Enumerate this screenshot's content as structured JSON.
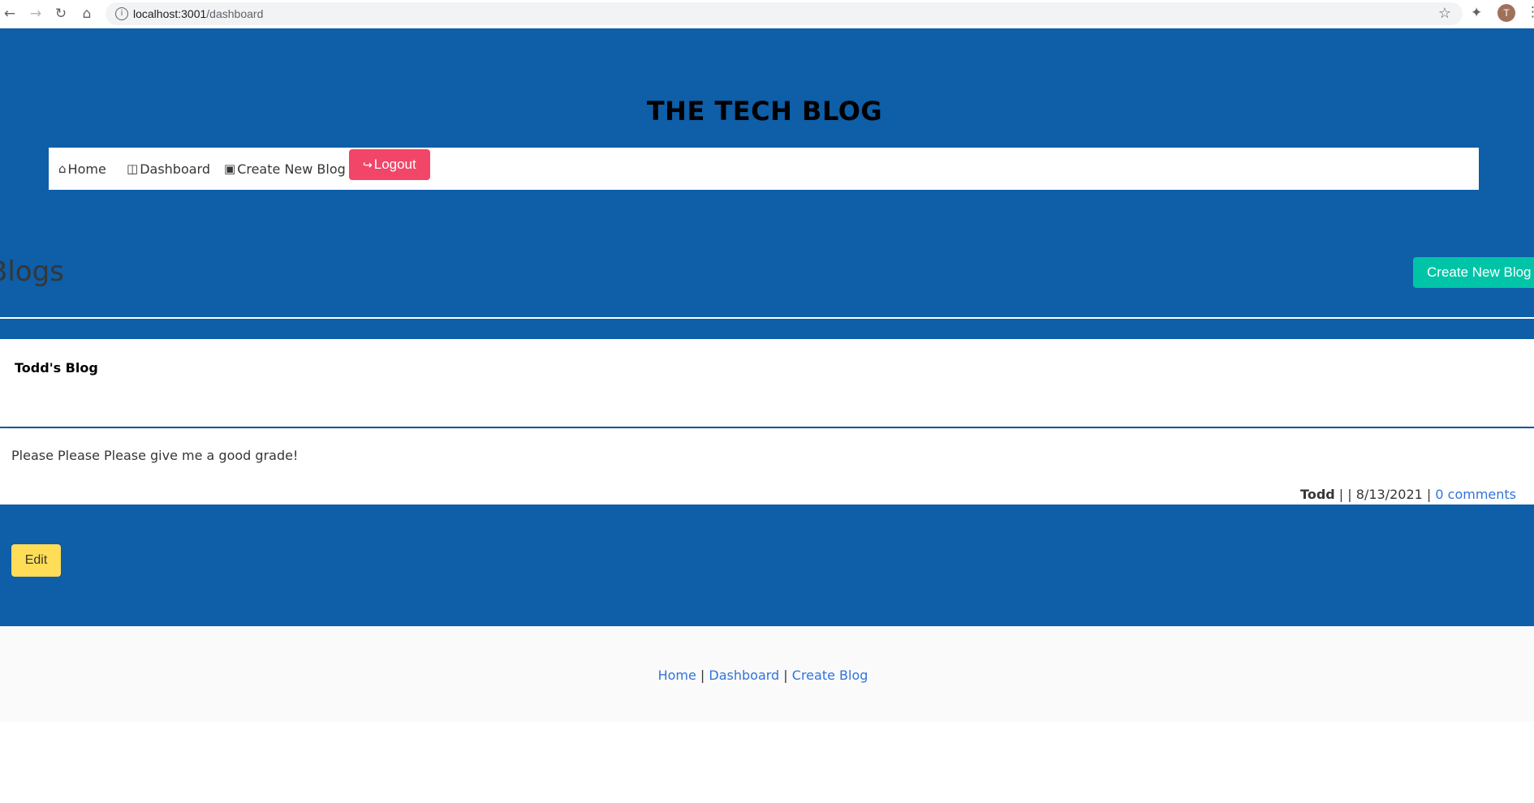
{
  "browser": {
    "url_host": "localhost:3001",
    "url_path": "/dashboard",
    "avatar_initial": "T"
  },
  "site": {
    "title": "THE TECH BLOG"
  },
  "nav": {
    "home": "Home",
    "dashboard": "Dashboard",
    "create": "Create New Blog",
    "logout": "Logout"
  },
  "dashboard": {
    "heading": "Blogs",
    "create_button": "Create New Blog"
  },
  "post": {
    "title": "Todd's Blog",
    "content": "Please Please Please give me a good grade!",
    "author": "Todd",
    "sep1": " | | ",
    "date": "8/13/2021",
    "sep2": " | ",
    "comments": "0 comments",
    "edit_button": "Edit"
  },
  "footer": {
    "home": "Home",
    "dashboard": "Dashboard",
    "create": "Create Blog",
    "sep": " | "
  },
  "colors": {
    "page_blue": "#0e5ea8",
    "logout_red": "#f14668",
    "create_teal": "#00c4a7",
    "edit_yellow": "#ffdd57",
    "link_blue": "#3273dc"
  },
  "icons": {
    "home": "home-icon",
    "dashboard": "columns-icon",
    "create": "comments-icon",
    "logout": "sign-out-icon"
  }
}
